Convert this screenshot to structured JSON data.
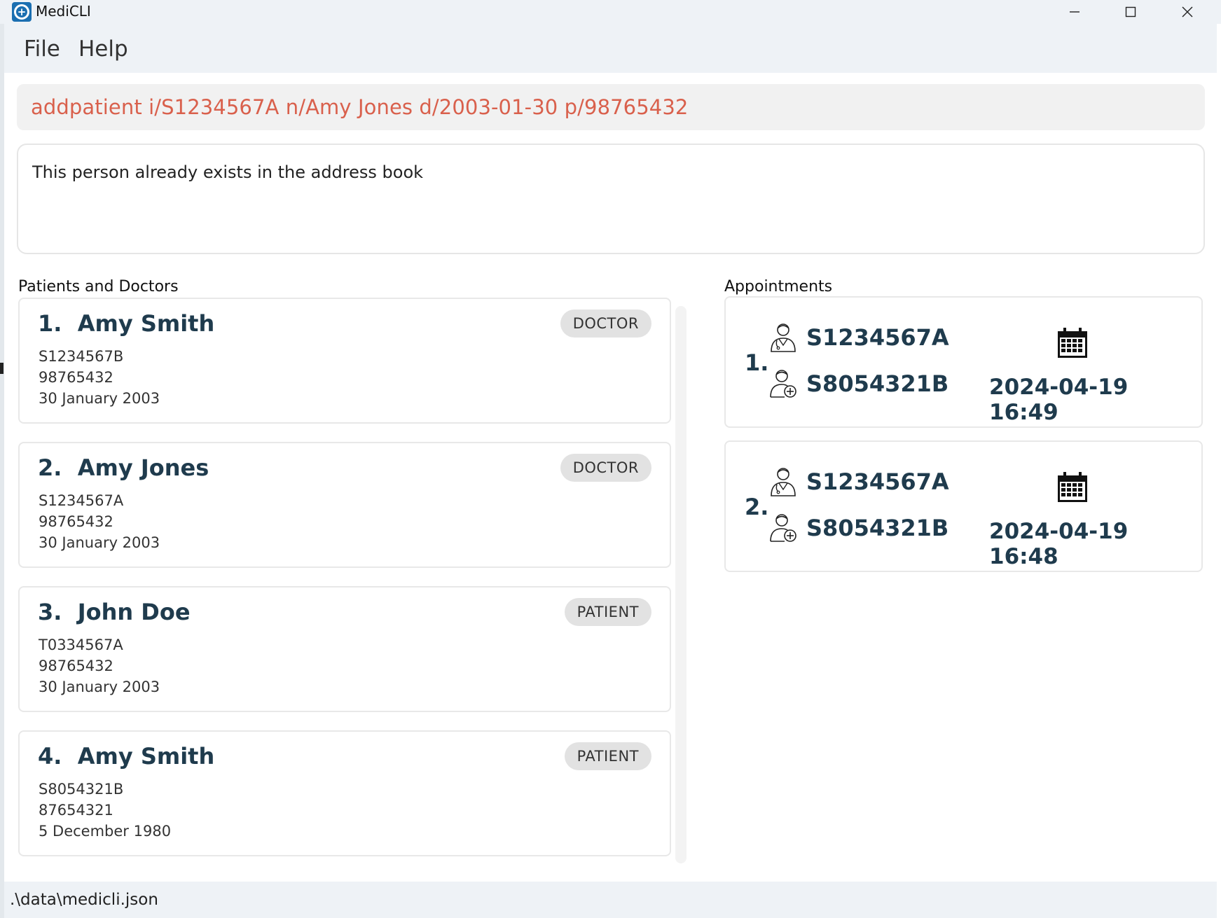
{
  "window": {
    "title": "MediCLI"
  },
  "menu": {
    "file": "File",
    "help": "Help"
  },
  "command": {
    "value": "addpatient i/S1234567A n/Amy Jones d/2003-01-30 p/98765432"
  },
  "result": {
    "message": "This person already exists in the address book"
  },
  "persons_panel": {
    "title": "Patients and Doctors",
    "items": [
      {
        "name": "1.  Amy Smith",
        "role": "DOCTOR",
        "nric": "S1234567B",
        "phone": "98765432",
        "dob": "30 January 2003"
      },
      {
        "name": "2.  Amy Jones",
        "role": "DOCTOR",
        "nric": "S1234567A",
        "phone": "98765432",
        "dob": "30 January 2003"
      },
      {
        "name": "3.  John Doe",
        "role": "PATIENT",
        "nric": "T0334567A",
        "phone": "98765432",
        "dob": "30 January 2003"
      },
      {
        "name": "4.  Amy Smith",
        "role": "PATIENT",
        "nric": "S8054321B",
        "phone": "87654321",
        "dob": "5 December 1980"
      }
    ]
  },
  "appointments_panel": {
    "title": "Appointments",
    "items": [
      {
        "index": "1.",
        "doctor_nric": "S1234567A",
        "patient_nric": "S8054321B",
        "datetime": "2024-04-19 16:49"
      },
      {
        "index": "2.",
        "doctor_nric": "S1234567A",
        "patient_nric": "S8054321B",
        "datetime": "2024-04-19 16:48"
      }
    ]
  },
  "status": {
    "path": ".\\data\\medicli.json"
  },
  "icons": {
    "app": "medicli-logo-icon",
    "doctor": "doctor-icon",
    "patient": "patient-icon",
    "calendar": "calendar-icon"
  },
  "colors": {
    "command_text": "#d9604c",
    "heading": "#1f3b4d",
    "badge_bg": "#e2e2e2",
    "chrome_bg": "#eef2f6"
  }
}
